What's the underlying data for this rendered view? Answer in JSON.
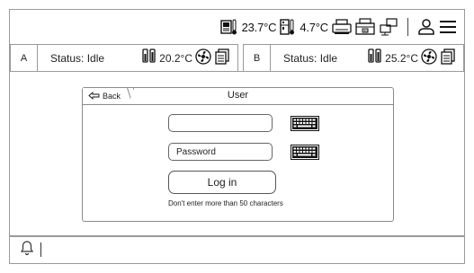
{
  "topbar": {
    "temp_outdoor": "23.7°C",
    "temp_indoor": "4.7°C",
    "icons": [
      "display-thermometer-icon",
      "fridge-thermometer-icon",
      "printer-icon",
      "cash-drawer-icon",
      "network-icon",
      "user-icon",
      "menu-icon"
    ]
  },
  "panel_a": {
    "letter": "A",
    "status": "Status: Idle",
    "temperature": "20.2°C"
  },
  "panel_b": {
    "letter": "B",
    "status": "Status: Idle",
    "temperature": "25.2°C"
  },
  "dialog": {
    "back_label": "Back",
    "title": "User",
    "username_value": "",
    "password_placeholder": "Password",
    "login_label": "Log in",
    "hint": "Don't enter more than 50 characters"
  }
}
